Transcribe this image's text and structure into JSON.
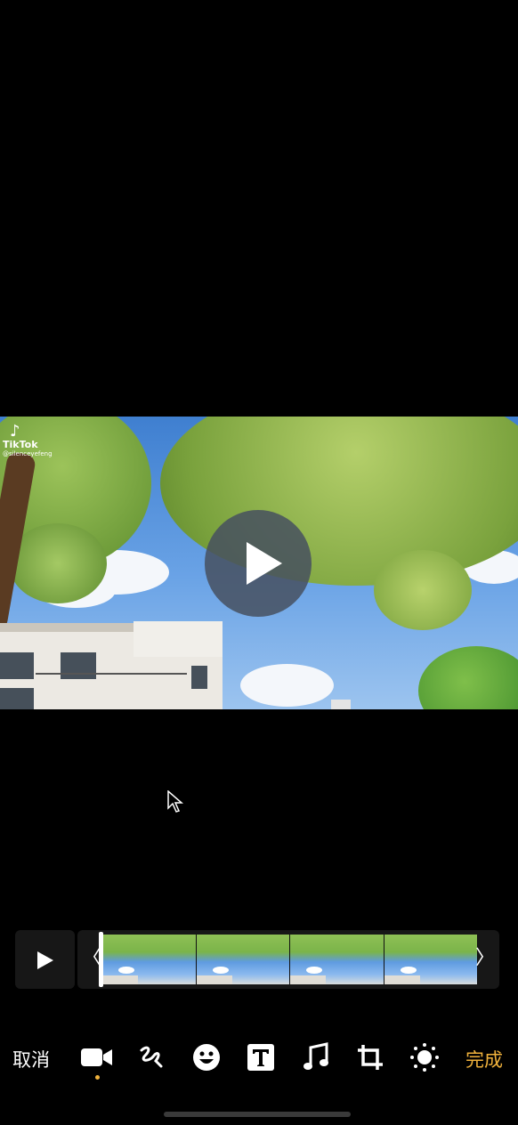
{
  "video": {
    "watermark_brand": "TikTok",
    "watermark_handle": "@silenceyefeng",
    "watermark_icon": "tiktok-note-icon",
    "overlay_icon": "play-icon"
  },
  "timeline": {
    "play_icon": "play-icon",
    "left_handle": "〈",
    "right_handle": "〉",
    "thumbnail_count": 4
  },
  "toolbar": {
    "cancel_label": "取消",
    "done_label": "完成",
    "tools": [
      "video-camera-icon",
      "markup-icon",
      "emoji-icon",
      "text-icon",
      "music-note-icon",
      "crop-icon",
      "brightness-icon"
    ],
    "selected_tool": "video-camera-icon"
  },
  "colors": {
    "accent": "#f0b23c",
    "background": "#000000"
  }
}
